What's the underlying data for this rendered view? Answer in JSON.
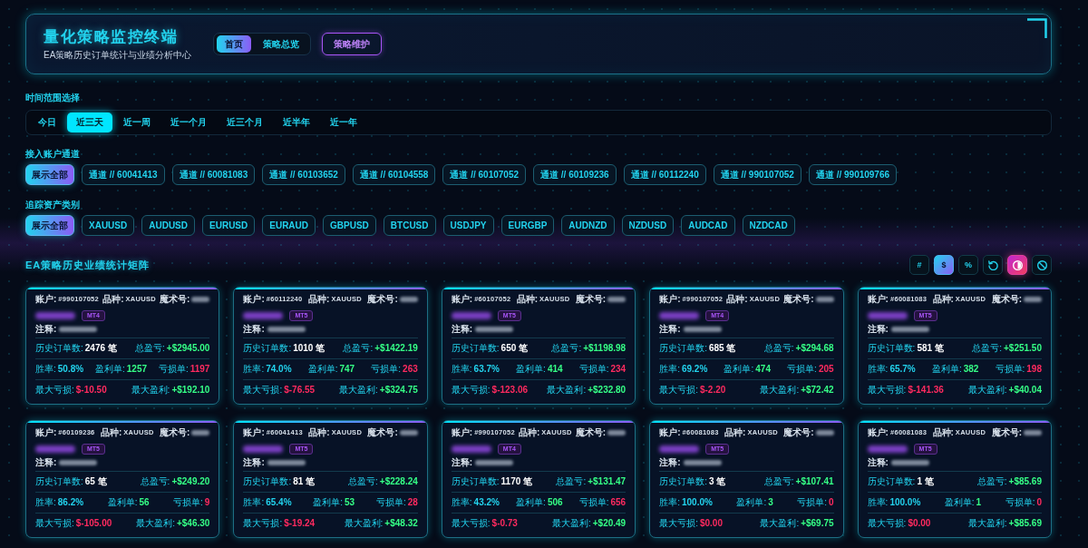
{
  "header": {
    "title": "量化策略监控终端",
    "subtitle": "EA策略历史订单统计与业绩分析中心",
    "nav": [
      {
        "label": "首页",
        "selected": true
      },
      {
        "label": "策略总览",
        "selected": false
      }
    ],
    "action_button": "策略维护"
  },
  "time_range": {
    "label": "时间范围选择",
    "options": [
      {
        "label": "今日",
        "selected": false
      },
      {
        "label": "近三天",
        "selected": true
      },
      {
        "label": "近一周",
        "selected": false
      },
      {
        "label": "近一个月",
        "selected": false
      },
      {
        "label": "近三个月",
        "selected": false
      },
      {
        "label": "近半年",
        "selected": false
      },
      {
        "label": "近一年",
        "selected": false
      }
    ]
  },
  "account_filter": {
    "label": "接入账户通道",
    "chips": [
      {
        "label": "展示全部",
        "selected": true
      },
      {
        "label": "通道 // 60041413",
        "selected": false
      },
      {
        "label": "通道 // 60081083",
        "selected": false
      },
      {
        "label": "通道 // 60103652",
        "selected": false
      },
      {
        "label": "通道 // 60104558",
        "selected": false
      },
      {
        "label": "通道 // 60107052",
        "selected": false
      },
      {
        "label": "通道 // 60109236",
        "selected": false
      },
      {
        "label": "通道 // 60112240",
        "selected": false
      },
      {
        "label": "通道 // 990107052",
        "selected": false
      },
      {
        "label": "通道 // 990109766",
        "selected": false
      }
    ]
  },
  "asset_filter": {
    "label": "追踪资产类别",
    "chips": [
      {
        "label": "展示全部",
        "selected": true
      },
      {
        "label": "XAUUSD",
        "selected": false
      },
      {
        "label": "AUDUSD",
        "selected": false
      },
      {
        "label": "EURUSD",
        "selected": false
      },
      {
        "label": "EURAUD",
        "selected": false
      },
      {
        "label": "GBPUSD",
        "selected": false
      },
      {
        "label": "BTCUSD",
        "selected": false
      },
      {
        "label": "USDJPY",
        "selected": false
      },
      {
        "label": "EURGBP",
        "selected": false
      },
      {
        "label": "AUDNZD",
        "selected": false
      },
      {
        "label": "NZDUSD",
        "selected": false
      },
      {
        "label": "AUDCAD",
        "selected": false
      },
      {
        "label": "NZDCAD",
        "selected": false
      }
    ]
  },
  "matrix": {
    "title": "EA策略历史业绩统计矩阵",
    "units": [
      {
        "label": "#",
        "selected": false
      },
      {
        "label": "$",
        "selected": true
      },
      {
        "label": "%",
        "selected": false
      }
    ],
    "actions": [
      {
        "kind": "refresh",
        "on": false
      },
      {
        "kind": "contrast",
        "on": true
      },
      {
        "kind": "ban",
        "on": false
      }
    ],
    "cards": [
      {
        "account_label": "账户:",
        "account": "#990107052",
        "symbol_label": "品种:",
        "symbol": "XAUUSD",
        "magic_label": "魔术号:",
        "platform": "MT4",
        "comment_label": "注释:",
        "stat_rows": [
          {
            "items": [
              {
                "label": "历史订单数:",
                "value": "2476 笔",
                "kind": "neutral"
              },
              {
                "label": "总盈亏:",
                "value": "+$2945.00",
                "kind": "profit"
              }
            ]
          },
          {
            "items": [
              {
                "label": "胜率:",
                "value": "50.8%",
                "kind": "accent"
              },
              {
                "label": "盈利单:",
                "value": "1257",
                "kind": "profit"
              },
              {
                "label": "亏损单:",
                "value": "1197",
                "kind": "loss"
              }
            ]
          },
          {
            "items": [
              {
                "label": "最大亏损:",
                "value": "$-10.50",
                "kind": "loss"
              },
              {
                "label": "最大盈利:",
                "value": "+$192.10",
                "kind": "profit"
              }
            ]
          }
        ]
      },
      {
        "account_label": "账户:",
        "account": "#60112240",
        "symbol_label": "品种:",
        "symbol": "XAUUSD",
        "magic_label": "魔术号:",
        "platform": "MT5",
        "comment_label": "注释:",
        "stat_rows": [
          {
            "items": [
              {
                "label": "历史订单数:",
                "value": "1010 笔",
                "kind": "neutral"
              },
              {
                "label": "总盈亏:",
                "value": "+$1422.19",
                "kind": "profit"
              }
            ]
          },
          {
            "items": [
              {
                "label": "胜率:",
                "value": "74.0%",
                "kind": "accent"
              },
              {
                "label": "盈利单:",
                "value": "747",
                "kind": "profit"
              },
              {
                "label": "亏损单:",
                "value": "263",
                "kind": "loss"
              }
            ]
          },
          {
            "items": [
              {
                "label": "最大亏损:",
                "value": "$-76.55",
                "kind": "loss"
              },
              {
                "label": "最大盈利:",
                "value": "+$324.75",
                "kind": "profit"
              }
            ]
          }
        ]
      },
      {
        "account_label": "账户:",
        "account": "#60107052",
        "symbol_label": "品种:",
        "symbol": "XAUUSD",
        "magic_label": "魔术号:",
        "platform": "MT5",
        "comment_label": "注释:",
        "stat_rows": [
          {
            "items": [
              {
                "label": "历史订单数:",
                "value": "650 笔",
                "kind": "neutral"
              },
              {
                "label": "总盈亏:",
                "value": "+$1198.98",
                "kind": "profit"
              }
            ]
          },
          {
            "items": [
              {
                "label": "胜率:",
                "value": "63.7%",
                "kind": "accent"
              },
              {
                "label": "盈利单:",
                "value": "414",
                "kind": "profit"
              },
              {
                "label": "亏损单:",
                "value": "234",
                "kind": "loss"
              }
            ]
          },
          {
            "items": [
              {
                "label": "最大亏损:",
                "value": "$-123.06",
                "kind": "loss"
              },
              {
                "label": "最大盈利:",
                "value": "+$232.80",
                "kind": "profit"
              }
            ]
          }
        ]
      },
      {
        "account_label": "账户:",
        "account": "#990107052",
        "symbol_label": "品种:",
        "symbol": "XAUUSD",
        "magic_label": "魔术号:",
        "platform": "MT4",
        "comment_label": "注释:",
        "stat_rows": [
          {
            "items": [
              {
                "label": "历史订单数:",
                "value": "685 笔",
                "kind": "neutral"
              },
              {
                "label": "总盈亏:",
                "value": "+$294.68",
                "kind": "profit"
              }
            ]
          },
          {
            "items": [
              {
                "label": "胜率:",
                "value": "69.2%",
                "kind": "accent"
              },
              {
                "label": "盈利单:",
                "value": "474",
                "kind": "profit"
              },
              {
                "label": "亏损单:",
                "value": "205",
                "kind": "loss"
              }
            ]
          },
          {
            "items": [
              {
                "label": "最大亏损:",
                "value": "$-2.20",
                "kind": "loss"
              },
              {
                "label": "最大盈利:",
                "value": "+$72.42",
                "kind": "profit"
              }
            ]
          }
        ]
      },
      {
        "account_label": "账户:",
        "account": "#60081083",
        "symbol_label": "品种:",
        "symbol": "XAUUSD",
        "magic_label": "魔术号:",
        "platform": "MT5",
        "comment_label": "注释:",
        "stat_rows": [
          {
            "items": [
              {
                "label": "历史订单数:",
                "value": "581 笔",
                "kind": "neutral"
              },
              {
                "label": "总盈亏:",
                "value": "+$251.50",
                "kind": "profit"
              }
            ]
          },
          {
            "items": [
              {
                "label": "胜率:",
                "value": "65.7%",
                "kind": "accent"
              },
              {
                "label": "盈利单:",
                "value": "382",
                "kind": "profit"
              },
              {
                "label": "亏损单:",
                "value": "198",
                "kind": "loss"
              }
            ]
          },
          {
            "items": [
              {
                "label": "最大亏损:",
                "value": "$-141.36",
                "kind": "loss"
              },
              {
                "label": "最大盈利:",
                "value": "+$40.04",
                "kind": "profit"
              }
            ]
          }
        ]
      },
      {
        "account_label": "账户:",
        "account": "#60109236",
        "symbol_label": "品种:",
        "symbol": "XAUUSD",
        "magic_label": "魔术号:",
        "platform": "MT5",
        "comment_label": "注释:",
        "stat_rows": [
          {
            "items": [
              {
                "label": "历史订单数:",
                "value": "65 笔",
                "kind": "neutral"
              },
              {
                "label": "总盈亏:",
                "value": "+$249.20",
                "kind": "profit"
              }
            ]
          },
          {
            "items": [
              {
                "label": "胜率:",
                "value": "86.2%",
                "kind": "accent"
              },
              {
                "label": "盈利单:",
                "value": "56",
                "kind": "profit"
              },
              {
                "label": "亏损单:",
                "value": "9",
                "kind": "loss"
              }
            ]
          },
          {
            "items": [
              {
                "label": "最大亏损:",
                "value": "$-105.00",
                "kind": "loss"
              },
              {
                "label": "最大盈利:",
                "value": "+$46.30",
                "kind": "profit"
              }
            ]
          }
        ]
      },
      {
        "account_label": "账户:",
        "account": "#60041413",
        "symbol_label": "品种:",
        "symbol": "XAUUSD",
        "magic_label": "魔术号:",
        "platform": "MT5",
        "comment_label": "注释:",
        "stat_rows": [
          {
            "items": [
              {
                "label": "历史订单数:",
                "value": "81 笔",
                "kind": "neutral"
              },
              {
                "label": "总盈亏:",
                "value": "+$228.24",
                "kind": "profit"
              }
            ]
          },
          {
            "items": [
              {
                "label": "胜率:",
                "value": "65.4%",
                "kind": "accent"
              },
              {
                "label": "盈利单:",
                "value": "53",
                "kind": "profit"
              },
              {
                "label": "亏损单:",
                "value": "28",
                "kind": "loss"
              }
            ]
          },
          {
            "items": [
              {
                "label": "最大亏损:",
                "value": "$-19.24",
                "kind": "loss"
              },
              {
                "label": "最大盈利:",
                "value": "+$48.32",
                "kind": "profit"
              }
            ]
          }
        ]
      },
      {
        "account_label": "账户:",
        "account": "#990107052",
        "symbol_label": "品种:",
        "symbol": "XAUUSD",
        "magic_label": "魔术号:",
        "platform": "MT4",
        "comment_label": "注释:",
        "stat_rows": [
          {
            "items": [
              {
                "label": "历史订单数:",
                "value": "1170 笔",
                "kind": "neutral"
              },
              {
                "label": "总盈亏:",
                "value": "+$131.47",
                "kind": "profit"
              }
            ]
          },
          {
            "items": [
              {
                "label": "胜率:",
                "value": "43.2%",
                "kind": "accent"
              },
              {
                "label": "盈利单:",
                "value": "506",
                "kind": "profit"
              },
              {
                "label": "亏损单:",
                "value": "656",
                "kind": "loss"
              }
            ]
          },
          {
            "items": [
              {
                "label": "最大亏损:",
                "value": "$-0.73",
                "kind": "loss"
              },
              {
                "label": "最大盈利:",
                "value": "+$20.49",
                "kind": "profit"
              }
            ]
          }
        ]
      },
      {
        "account_label": "账户:",
        "account": "#60081083",
        "symbol_label": "品种:",
        "symbol": "XAUUSD",
        "magic_label": "魔术号:",
        "platform": "MT5",
        "comment_label": "注释:",
        "stat_rows": [
          {
            "items": [
              {
                "label": "历史订单数:",
                "value": "3 笔",
                "kind": "neutral"
              },
              {
                "label": "总盈亏:",
                "value": "+$107.41",
                "kind": "profit"
              }
            ]
          },
          {
            "items": [
              {
                "label": "胜率:",
                "value": "100.0%",
                "kind": "accent"
              },
              {
                "label": "盈利单:",
                "value": "3",
                "kind": "profit"
              },
              {
                "label": "亏损单:",
                "value": "0",
                "kind": "loss"
              }
            ]
          },
          {
            "items": [
              {
                "label": "最大亏损:",
                "value": "$0.00",
                "kind": "loss"
              },
              {
                "label": "最大盈利:",
                "value": "+$69.75",
                "kind": "profit"
              }
            ]
          }
        ]
      },
      {
        "account_label": "账户:",
        "account": "#60081083",
        "symbol_label": "品种:",
        "symbol": "XAUUSD",
        "magic_label": "魔术号:",
        "platform": "MT5",
        "comment_label": "注释:",
        "stat_rows": [
          {
            "items": [
              {
                "label": "历史订单数:",
                "value": "1 笔",
                "kind": "neutral"
              },
              {
                "label": "总盈亏:",
                "value": "+$85.69",
                "kind": "profit"
              }
            ]
          },
          {
            "items": [
              {
                "label": "胜率:",
                "value": "100.0%",
                "kind": "accent"
              },
              {
                "label": "盈利单:",
                "value": "1",
                "kind": "profit"
              },
              {
                "label": "亏损单:",
                "value": "0",
                "kind": "loss"
              }
            ]
          },
          {
            "items": [
              {
                "label": "最大亏损:",
                "value": "$0.00",
                "kind": "loss"
              },
              {
                "label": "最大盈利:",
                "value": "+$85.69",
                "kind": "profit"
              }
            ]
          }
        ]
      }
    ]
  }
}
